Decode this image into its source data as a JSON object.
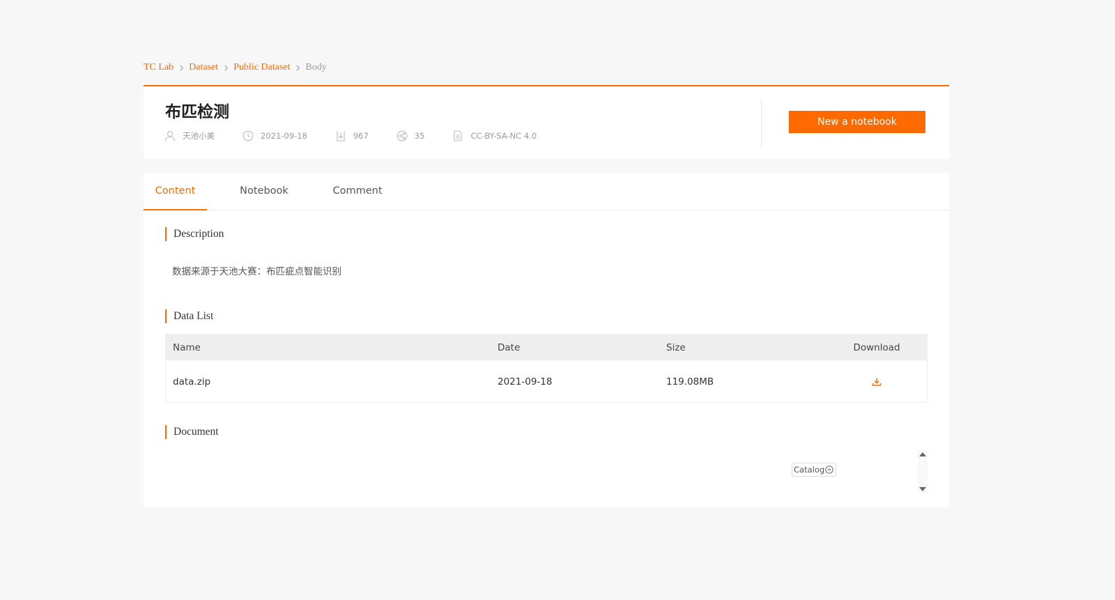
{
  "breadcrumb": {
    "items": [
      "TC Lab",
      "Dataset",
      "Public Dataset"
    ],
    "current": "Body"
  },
  "dataset": {
    "title": "布匹检测",
    "author": "天池小美",
    "date": "2021-09-18",
    "downloads": "967",
    "shares": "35",
    "license": "CC-BY-SA-NC 4.0"
  },
  "actions": {
    "new_notebook": "New a notebook"
  },
  "tabs": [
    {
      "label": "Content",
      "active": true
    },
    {
      "label": "Notebook",
      "active": false
    },
    {
      "label": "Comment",
      "active": false
    }
  ],
  "sections": {
    "description": {
      "title": "Description",
      "text": "数据来源于天池大赛：布匹疵点智能识别"
    },
    "data_list": {
      "title": "Data List",
      "columns": [
        "Name",
        "Date",
        "Size",
        "Download"
      ],
      "rows": [
        {
          "name": "data.zip",
          "date": "2021-09-18",
          "size": "119.08MB"
        }
      ]
    },
    "document": {
      "title": "Document",
      "catalog_label": "Catalog"
    }
  },
  "colors": {
    "accent": "#ff6a00",
    "background": "#f7f7f7"
  },
  "icons": {
    "author": "user-icon",
    "date": "clock-icon",
    "downloads": "download-icon",
    "shares": "share-icon",
    "license": "document-icon"
  }
}
